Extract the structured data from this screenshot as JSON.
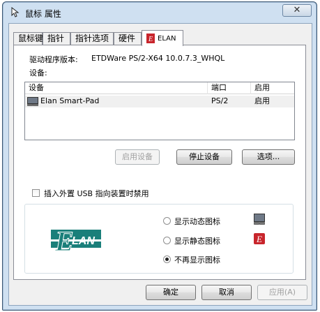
{
  "window": {
    "title": "鼠标 属性",
    "close_glyph": "✕"
  },
  "tabs": [
    {
      "label": "鼠标键"
    },
    {
      "label": "指针"
    },
    {
      "label": "指针选项"
    },
    {
      "label": "硬件"
    },
    {
      "label": "ELAN"
    }
  ],
  "driver": {
    "label": "驱动程序版本:",
    "value": "ETDWare PS/2-X64 10.0.7.3_WHQL"
  },
  "devices": {
    "label": "设备:",
    "columns": [
      "设备",
      "端口",
      "启用"
    ],
    "rows": [
      {
        "name": "Elan Smart-Pad",
        "port": "PS/2",
        "enabled": "启用"
      }
    ]
  },
  "buttons": {
    "enable": "启用设备",
    "stop": "停止设备",
    "options": "选项..."
  },
  "usb_disable": {
    "label": "插入外置 USB 指向装置时禁用",
    "checked": false
  },
  "tray_icon": {
    "options": [
      {
        "label": "显示动态图标",
        "checked": false,
        "icon": "touchpad-icon"
      },
      {
        "label": "显示静态图标",
        "checked": false,
        "icon": "elan-red-icon"
      },
      {
        "label": "不再显示图标",
        "checked": true,
        "icon": ""
      }
    ]
  },
  "logo": {
    "letters": [
      "E",
      "LAN"
    ],
    "color": "#1a7f7a"
  },
  "footer": {
    "ok": "确定",
    "cancel": "取消",
    "apply": "应用(A)"
  }
}
